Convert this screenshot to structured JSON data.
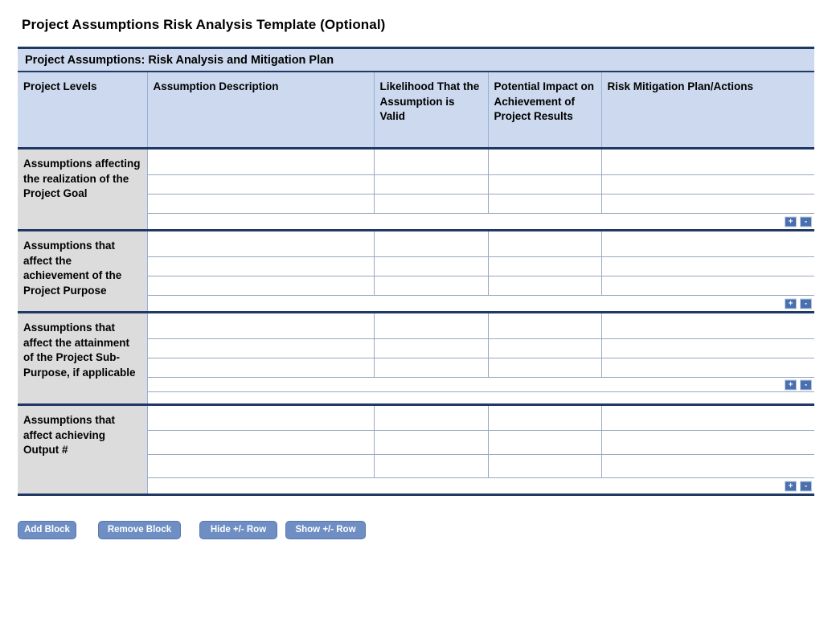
{
  "page_title": "Project Assumptions Risk Analysis Template (Optional)",
  "table": {
    "banner": "Project Assumptions: Risk Analysis and Mitigation Plan",
    "columns": [
      "Project Levels",
      "Assumption Description",
      "Likelihood That the Assumption is Valid",
      "Potential Impact on Achievement of Project Results",
      "Risk Mitigation Plan/Actions"
    ],
    "blocks": [
      {
        "level_label": "Assumptions affecting the realization of the Project Goal",
        "rows": [
          "",
          "",
          ""
        ],
        "add_row_button": "+",
        "remove_row_button": "-"
      },
      {
        "level_label": "Assumptions that affect the achievement of the Project Purpose",
        "rows": [
          "",
          "",
          ""
        ],
        "add_row_button": "+",
        "remove_row_button": "-"
      },
      {
        "level_label": "Assumptions that affect the attainment of the Project Sub-Purpose, if applicable",
        "rows": [
          "",
          "",
          ""
        ],
        "add_row_button": "+",
        "remove_row_button": "-"
      },
      {
        "level_label": "Assumptions that affect achieving Output #",
        "rows": [
          "",
          "",
          ""
        ],
        "add_row_button": "+",
        "remove_row_button": "-"
      }
    ]
  },
  "actions": {
    "add_block": "Add Block",
    "remove_block": "Remove Block",
    "hide_pm_row": "Hide +/- Row",
    "show_pm_row": "Show +/- Row"
  }
}
